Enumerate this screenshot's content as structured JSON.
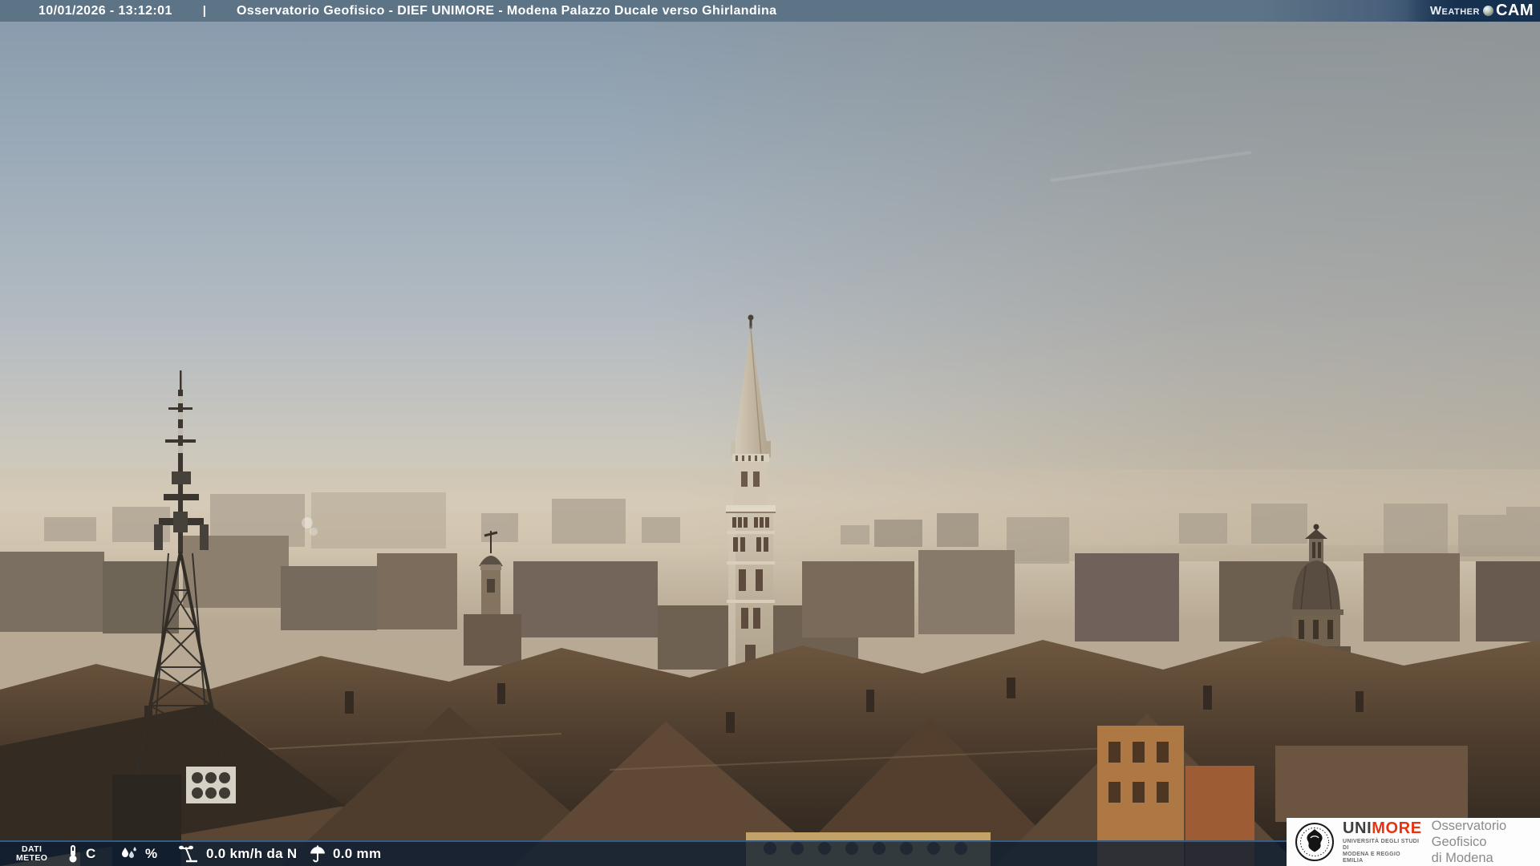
{
  "header": {
    "timestamp": "10/01/2026 - 13:12:01",
    "separator": "|",
    "title": "Osservatorio Geofisico - DIEF UNIMORE - Modena Palazzo Ducale verso Ghirlandina",
    "weathercam": {
      "weather": "Weather",
      "cam": "CAM"
    }
  },
  "weather_bar": {
    "label": {
      "line1": "DATI",
      "line2": "METEO"
    },
    "temperature": {
      "unit": "C"
    },
    "humidity": {
      "unit": "%"
    },
    "wind": {
      "text": "0.0 km/h da N"
    },
    "rain": {
      "text": "0.0 mm"
    }
  },
  "logo_box": {
    "wordmark": {
      "uni": "UNI",
      "more": "MORE"
    },
    "tagline": {
      "line1": "UNIVERSITÀ DEGLI STUDI DI",
      "line2": "MODENA E REGGIO EMILIA"
    },
    "organization": {
      "line1": "Osservatorio Geofisico",
      "line2": "di Modena"
    }
  },
  "colors": {
    "top_bar": "#5D7386",
    "weathercam_bg": "#16304F",
    "bottom_bar": "rgba(10,28,50,0.78)",
    "bottom_bar_border": "#3A618C",
    "unimore_red": "#E63312",
    "unimore_dark": "#3F3E3D",
    "org_text": "#8B8B8E",
    "overlay_text": "#FFFFFF"
  }
}
